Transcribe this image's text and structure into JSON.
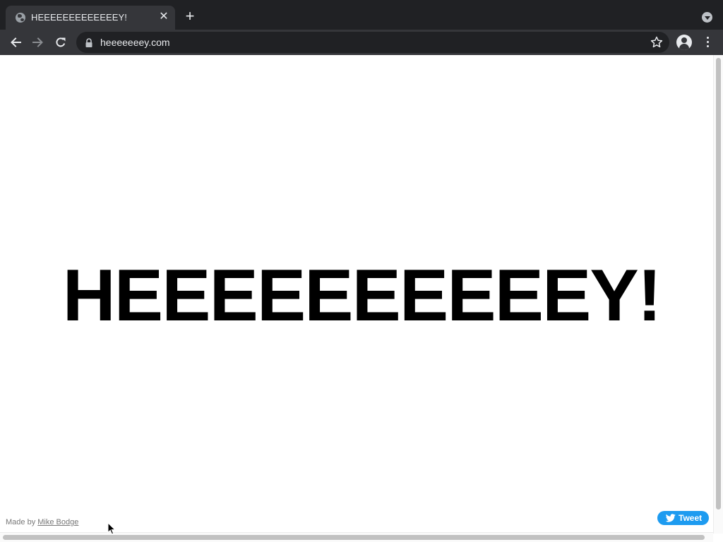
{
  "browser": {
    "tab": {
      "title": "HEEEEEEEEEEEEEY!",
      "favicon": "globe-icon",
      "close_icon": "close-icon"
    },
    "new_tab_icon": "plus-icon",
    "tab_search_icon": "chevron-down-icon",
    "toolbar": {
      "back_icon": "back-arrow-icon",
      "forward_icon": "forward-arrow-icon",
      "reload_icon": "reload-icon",
      "lock_icon": "lock-icon",
      "url": "heeeeeeey.com",
      "bookmark_icon": "star-icon",
      "profile_icon": "profile-icon",
      "menu_icon": "kebab-menu-icon"
    }
  },
  "page": {
    "headline": "HEEEEEEEEEEY!",
    "credit": {
      "prefix": "Made by",
      "author": "Mike Bodge"
    },
    "tweet": {
      "label": "Tweet",
      "icon": "twitter-bird-icon",
      "color": "#1d9bf0"
    }
  },
  "colors": {
    "chrome_dark": "#202124",
    "chrome_toolbar": "#35363a",
    "chrome_text": "#e8eaed",
    "page_background": "#ffffff",
    "headline_text": "#000000"
  }
}
